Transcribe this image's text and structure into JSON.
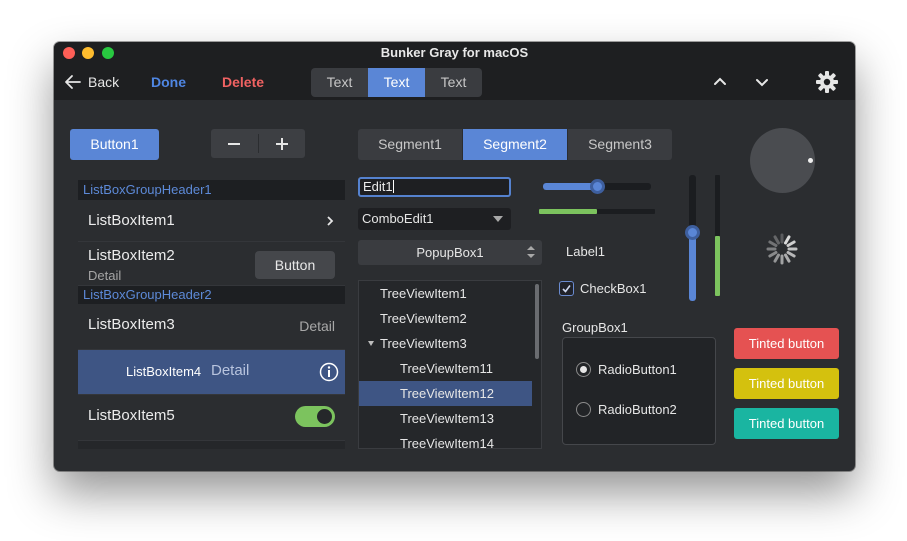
{
  "window": {
    "title": "Bunker Gray for macOS"
  },
  "toolbar": {
    "back_label": "Back",
    "done_label": "Done",
    "delete_label": "Delete",
    "tabs": [
      {
        "label": "Text"
      },
      {
        "label": "Text",
        "active": true
      },
      {
        "label": "Text"
      }
    ]
  },
  "buttons": {
    "button1": "Button1",
    "stepper": {
      "minus": "−",
      "plus": "+"
    }
  },
  "listbox": {
    "group1": "ListBoxGroupHeader1",
    "group2": "ListBoxGroupHeader2",
    "item1": "ListBoxItem1",
    "item2": "ListBoxItem2",
    "item2_detail": "Detail",
    "item2_button": "Button",
    "item3": "ListBoxItem3",
    "item3_detail": "Detail",
    "item4": "ListBoxItem4",
    "item4_detail": "Detail",
    "item5": "ListBoxItem5",
    "item5_toggle": true
  },
  "segments": [
    {
      "label": "Segment1"
    },
    {
      "label": "Segment2",
      "active": true
    },
    {
      "label": "Segment3"
    }
  ],
  "edit1": {
    "value": "Edit1"
  },
  "combo": {
    "value": "ComboEdit1"
  },
  "popup": {
    "value": "PopupBox1"
  },
  "treeview": {
    "items": [
      {
        "label": "TreeViewItem1"
      },
      {
        "label": "TreeViewItem2"
      },
      {
        "label": "TreeViewItem3"
      },
      {
        "label": "TreeViewItem11"
      },
      {
        "label": "TreeViewItem12"
      },
      {
        "label": "TreeViewItem13"
      },
      {
        "label": "TreeViewItem14"
      }
    ]
  },
  "sliders": {
    "horizontal_value": 0.5,
    "progress_value": 0.5,
    "vertical_value": 0.55,
    "vertical_progress_value": 0.5
  },
  "label1": "Label1",
  "checkbox1": {
    "label": "CheckBox1",
    "checked": true
  },
  "groupbox": {
    "title": "GroupBox1",
    "radio1": {
      "label": "RadioButton1",
      "checked": true
    },
    "radio2": {
      "label": "RadioButton2",
      "checked": false
    }
  },
  "tinted": [
    {
      "label": "Tinted button",
      "color": "#e55252"
    },
    {
      "label": "Tinted button",
      "color": "#d4c10e"
    },
    {
      "label": "Tinted button",
      "color": "#1ab5a1"
    }
  ],
  "colors": {
    "accent": "#5a86d6",
    "progress": "#7cc35e",
    "danger": "#f06262"
  }
}
